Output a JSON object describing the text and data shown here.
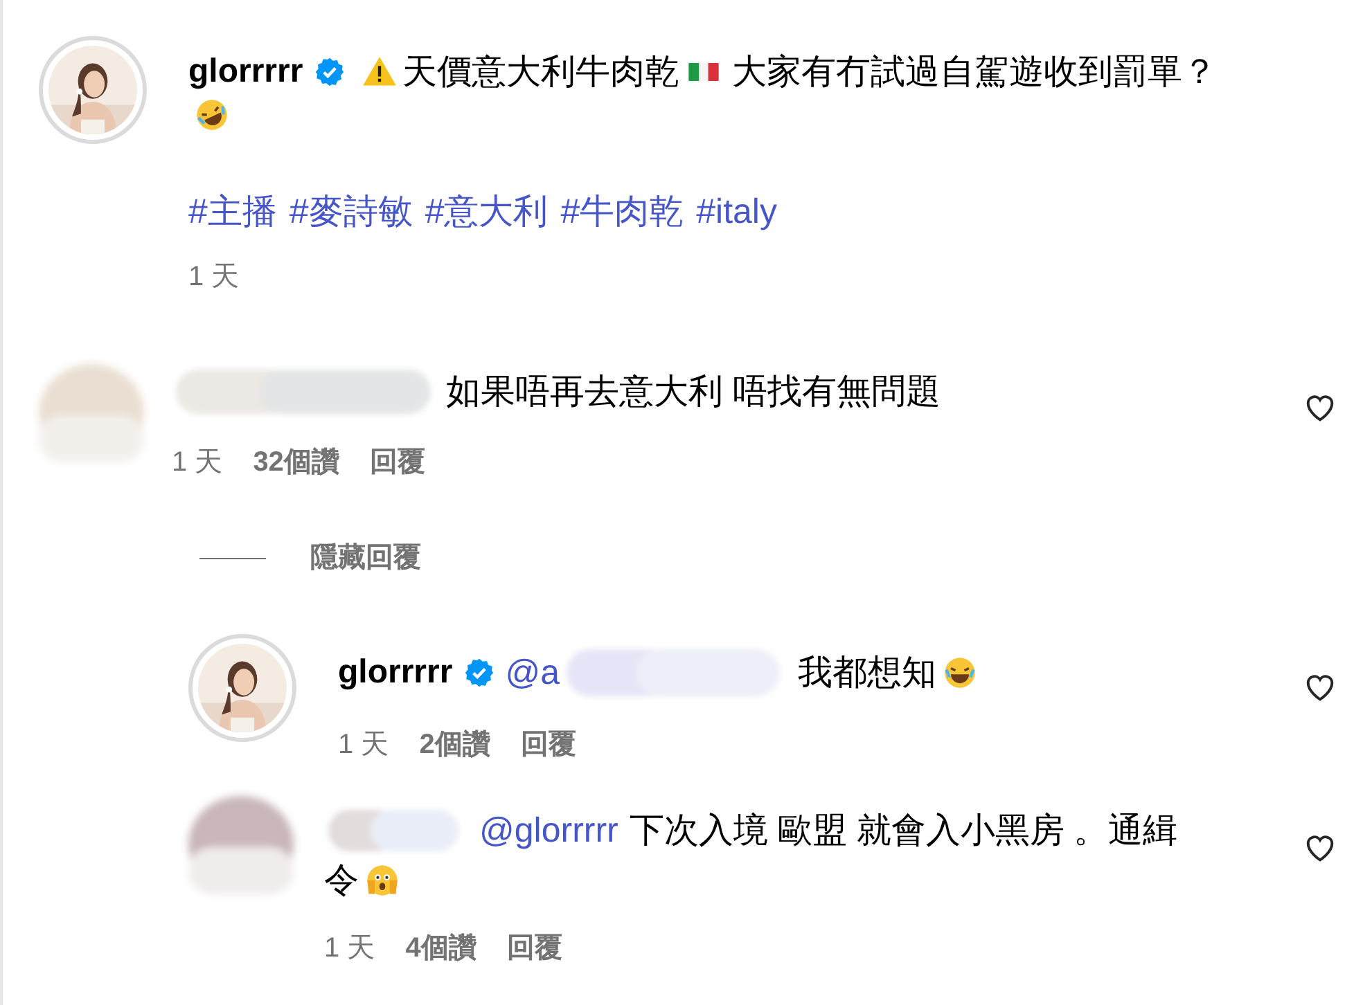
{
  "post": {
    "username": "glorrrrr",
    "verified": true,
    "caption_before": "天價意大利牛肉乾",
    "caption_after": "大家有冇試過自駕遊收到罰單？",
    "hashtags": [
      "#主播",
      "#麥詩敏",
      "#意大利",
      "#牛肉乾",
      "#italy"
    ],
    "time": "1 天"
  },
  "comment": {
    "text": "如果唔再去意大利 唔找有無問題",
    "time": "1 天",
    "likes": "32個讚",
    "reply": "回覆",
    "liked": false
  },
  "hide_replies": "隱藏回覆",
  "replies": [
    {
      "kind": "own",
      "username": "glorrrrr",
      "verified": true,
      "mention": "@a",
      "text": "我都想知",
      "time": "1 天",
      "likes": "2個讚",
      "reply": "回覆",
      "liked": false
    },
    {
      "kind": "redacted",
      "mention": "@glorrrrr",
      "text_lines": [
        "下次入境 歐盟 就會入小黑房 。通緝",
        "令"
      ],
      "time": "1 天",
      "likes": "4個讚",
      "reply": "回覆",
      "liked": false
    }
  ]
}
